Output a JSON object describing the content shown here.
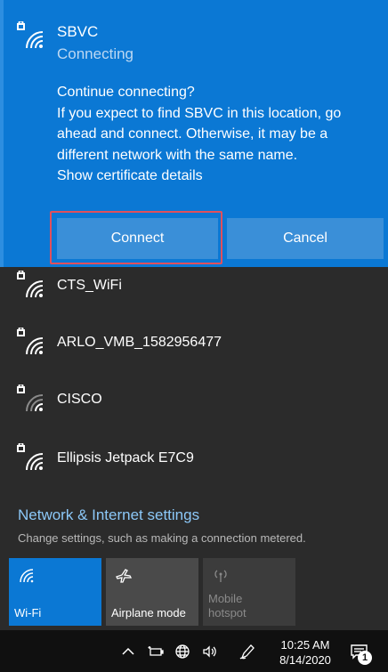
{
  "selected_network": {
    "name": "SBVC",
    "status": "Connecting",
    "message_lines": [
      "Continue connecting?",
      "If you expect to find SBVC in this location, go",
      "ahead and connect. Otherwise, it may be a",
      "different network with the same name."
    ],
    "certificate_link": "Show certificate details",
    "connect_label": "Connect",
    "cancel_label": "Cancel",
    "icon": "secured-wifi-icon"
  },
  "networks": [
    {
      "name": "CTS_WiFi",
      "icon": "secured-wifi-icon"
    },
    {
      "name": "ARLO_VMB_1582956477",
      "icon": "secured-wifi-icon"
    },
    {
      "name": "CISCO",
      "icon": "secured-wifi-icon"
    },
    {
      "name": "Ellipsis Jetpack E7C9",
      "icon": "secured-wifi-icon"
    }
  ],
  "settings": {
    "link": "Network & Internet settings",
    "description": "Change settings, such as making a connection metered."
  },
  "quick_actions": [
    {
      "label": "Wi-Fi",
      "icon": "wifi-icon",
      "state": "on"
    },
    {
      "label": "Airplane mode",
      "icon": "airplane-icon",
      "state": "off"
    },
    {
      "label": "Mobile hotspot",
      "icon": "hotspot-icon",
      "state": "disabled"
    }
  ],
  "taskbar": {
    "time": "10:25 AM",
    "date": "8/14/2020",
    "notification_count": "1",
    "tray_icons": [
      "chevron-up-icon",
      "battery-icon",
      "network-globe-icon",
      "volume-icon",
      "pen-icon"
    ]
  },
  "colors": {
    "accent": "#0b78d4",
    "flyout_bg": "#2b2b2b",
    "link": "#8cc8f8",
    "highlight": "#e0505c"
  }
}
